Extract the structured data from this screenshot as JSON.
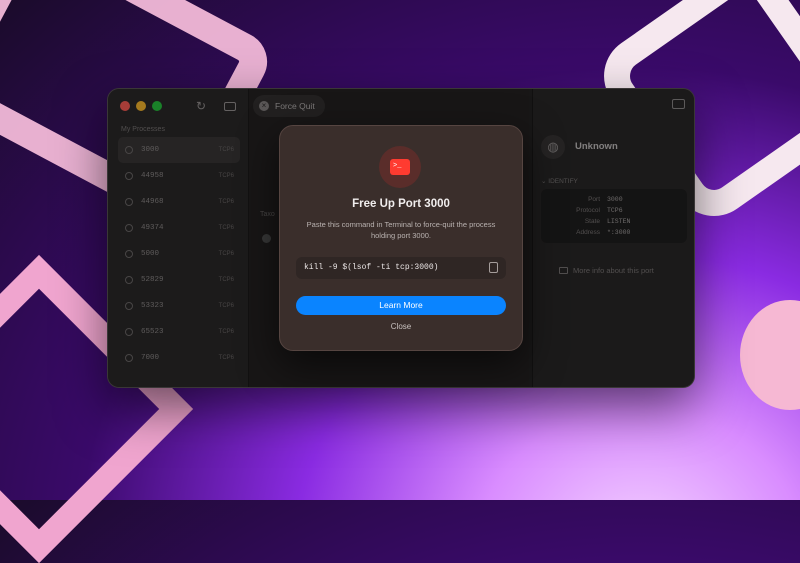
{
  "window": {
    "tab": {
      "label": "Force Quit"
    },
    "sidebar": {
      "section_title": "My Processes",
      "items": [
        {
          "port": "3000",
          "protocol": "TCP6"
        },
        {
          "port": "44958",
          "protocol": "TCP6"
        },
        {
          "port": "44968",
          "protocol": "TCP6"
        },
        {
          "port": "49374",
          "protocol": "TCP6"
        },
        {
          "port": "5000",
          "protocol": "TCP6"
        },
        {
          "port": "52829",
          "protocol": "TCP6"
        },
        {
          "port": "53323",
          "protocol": "TCP6"
        },
        {
          "port": "65523",
          "protocol": "TCP6"
        },
        {
          "port": "7000",
          "protocol": "TCP6"
        }
      ]
    },
    "center": {
      "label": "Taxo"
    },
    "details": {
      "title": "Unknown",
      "identify_label": "IDENTIFY",
      "rows": [
        {
          "key": "Port",
          "value": "3000"
        },
        {
          "key": "Protocol",
          "value": "TCP6"
        },
        {
          "key": "State",
          "value": "LISTEN"
        },
        {
          "key": "Address",
          "value": "*:3000"
        }
      ],
      "more_info": "More info about this port"
    }
  },
  "dialog": {
    "title": "Free Up Port 3000",
    "message": "Paste this command in Terminal to force-quit the process holding port 3000.",
    "command": "kill -9 $(lsof -ti tcp:3000)",
    "primary_button": "Learn More",
    "secondary_button": "Close"
  },
  "colors": {
    "accent": "#0a84ff",
    "terminal_icon": "#ff3b30"
  }
}
